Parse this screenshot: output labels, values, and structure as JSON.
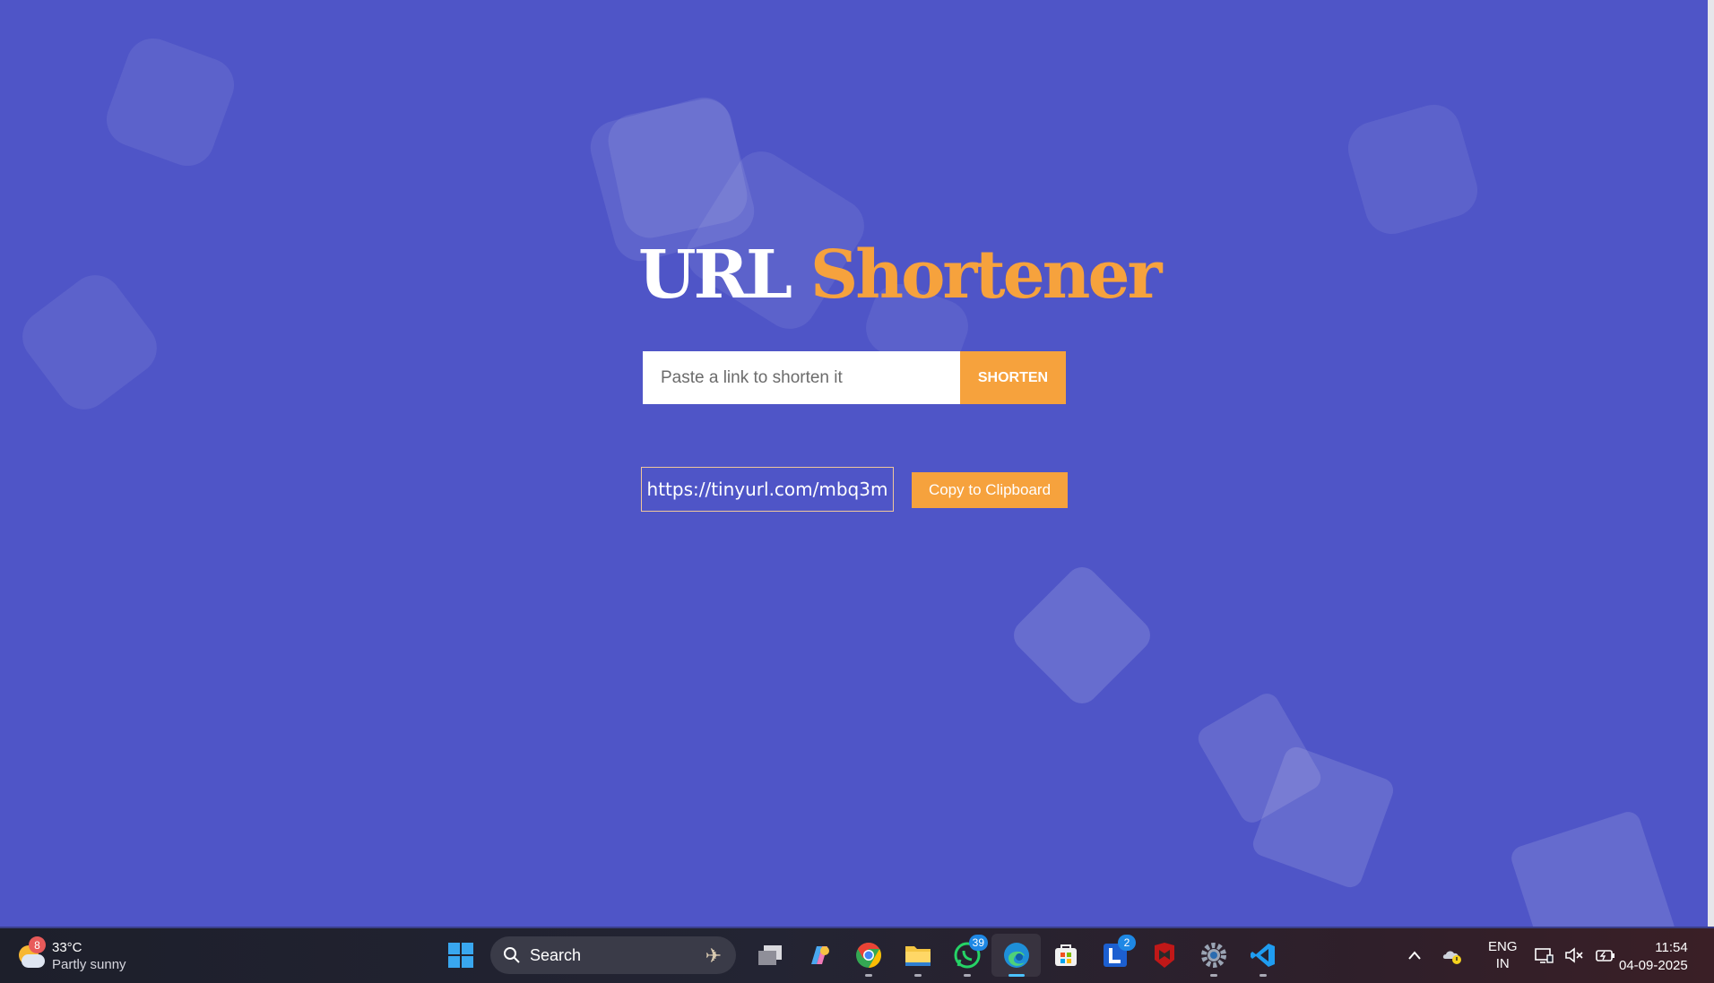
{
  "app": {
    "title_part1": "URL",
    "title_part2": "Shortener"
  },
  "form": {
    "input_value": "",
    "input_placeholder": "Paste a link to shorten it",
    "shorten_label": "SHORTEN"
  },
  "result": {
    "short_url": "https://tinyurl.com/mbq3m",
    "copy_label": "Copy to Clipboard"
  },
  "colors": {
    "background": "#4f55c7",
    "accent": "#f6a23d"
  },
  "taskbar": {
    "weather": {
      "badge": "8",
      "temperature": "33°C",
      "condition": "Partly sunny",
      "icon": "partly-sunny-icon"
    },
    "search_label": "Search",
    "apps": [
      {
        "name": "windows-start-icon"
      },
      {
        "name": "task-view-icon"
      },
      {
        "name": "copilot-icon"
      },
      {
        "name": "chrome-icon"
      },
      {
        "name": "file-explorer-icon"
      },
      {
        "name": "whatsapp-icon",
        "badge": "39"
      },
      {
        "name": "edge-icon"
      },
      {
        "name": "microsoft-store-icon"
      },
      {
        "name": "l-app-icon",
        "badge": "2"
      },
      {
        "name": "mcafee-icon"
      },
      {
        "name": "settings-gear-icon"
      },
      {
        "name": "vscode-icon"
      }
    ],
    "tray": {
      "lang_line1": "ENG",
      "lang_line2": "IN"
    },
    "clock": {
      "time": "11:54",
      "date": "04-09-2025"
    }
  }
}
